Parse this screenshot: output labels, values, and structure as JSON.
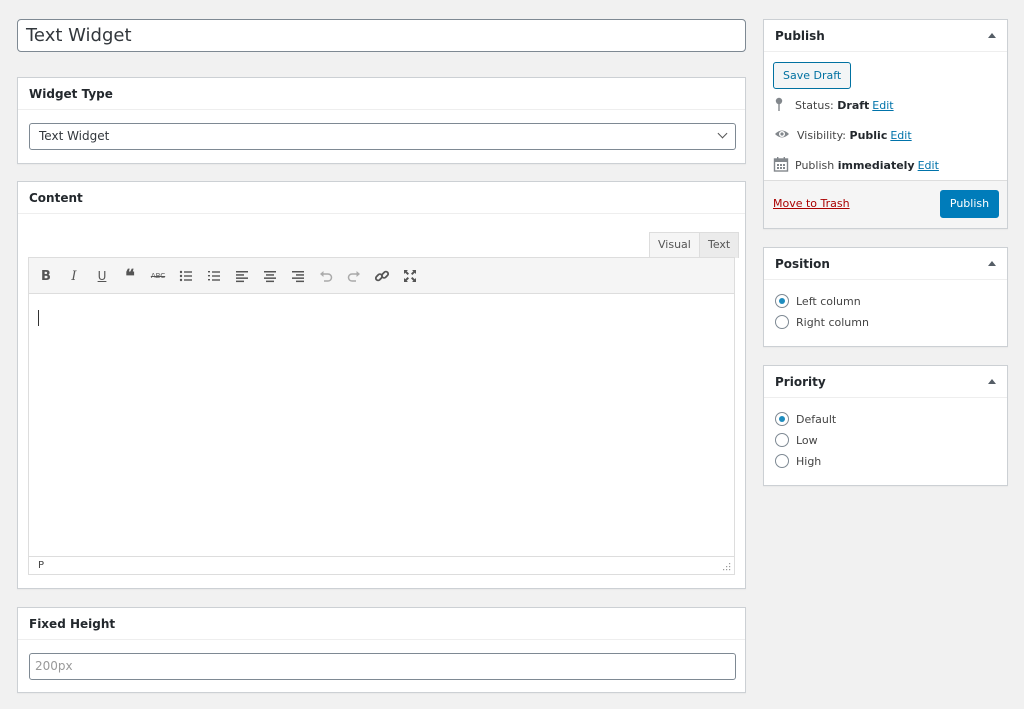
{
  "post_title": "Text Widget",
  "widget_type": {
    "heading": "Widget Type",
    "selected": "Text Widget"
  },
  "content": {
    "heading": "Content",
    "tabs": {
      "visual": "Visual",
      "text": "Text"
    },
    "toolbar_icons": [
      "bold-icon",
      "italic-icon",
      "underline-icon",
      "blockquote-icon",
      "strikethrough-icon",
      "bullet-list-icon",
      "numbered-list-icon",
      "align-left-icon",
      "align-center-icon",
      "align-right-icon",
      "undo-icon",
      "redo-icon",
      "link-icon",
      "fullscreen-icon"
    ],
    "toolbar_glyphs": {
      "bold": "B",
      "italic": "I",
      "underline": "U",
      "blockquote": "❝",
      "strike": "ABC"
    },
    "path": "P"
  },
  "fixed_height": {
    "heading": "Fixed Height",
    "placeholder": "200px"
  },
  "publish": {
    "heading": "Publish",
    "save_draft": "Save Draft",
    "status_label": "Status:",
    "status_value": "Draft",
    "visibility_label": "Visibility:",
    "visibility_value": "Public",
    "publish_label": "Publish",
    "publish_value": "immediately",
    "edit": "Edit",
    "trash": "Move to Trash",
    "publish_button": "Publish"
  },
  "position": {
    "heading": "Position",
    "options": [
      "Left column",
      "Right column"
    ],
    "selected": "Left column"
  },
  "priority": {
    "heading": "Priority",
    "options": [
      "Default",
      "Low",
      "High"
    ],
    "selected": "Default"
  },
  "colors": {
    "accent": "#007cba",
    "link": "#0073aa",
    "trash": "#a00"
  }
}
